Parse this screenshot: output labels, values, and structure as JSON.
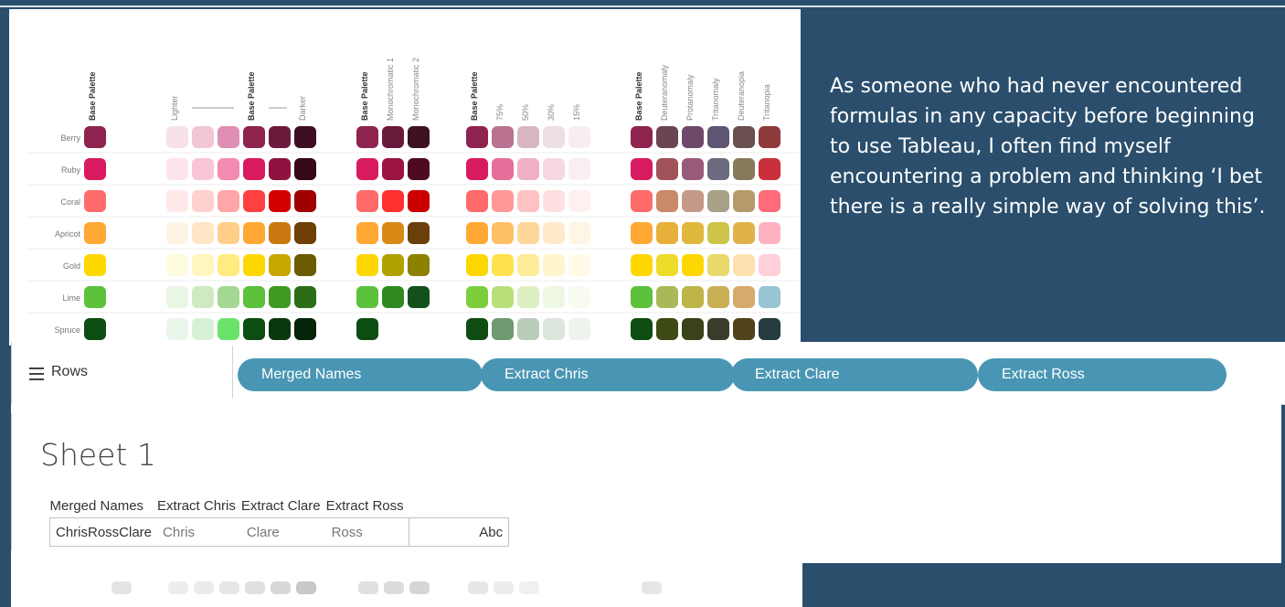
{
  "caption": "As someone who had never encountered formulas in any capacity before beginning to use Tableau, I often find myself encountering a problem and thinking ‘I bet there is a really simple way of solving this’.",
  "palette": {
    "column_headers": [
      "Base Palette",
      "Lighter",
      "Base Palette",
      "Darker",
      "Base Palette",
      "Monochromatic 1",
      "Monochromatic 2",
      "Base Palette",
      "75%",
      "50%",
      "30%",
      "15%",
      "Base Palette",
      "Deuteranomaly",
      "Protanomaly",
      "Tritanomaly",
      "Deuteranopia",
      "Tritanopia"
    ],
    "rows": [
      {
        "name": "Berry",
        "colors": [
          "#8f2350",
          "#f7e1ea",
          "#f2c6d6",
          "#df8fb1",
          "#8f2350",
          "#6b1a3c",
          "#3e0f22",
          "#8f2350",
          "#6a1a3b",
          "#3e1020",
          "#8f2350",
          "#b9728f",
          "#d9b5c4",
          "#ece0e5",
          "#f6eef1",
          "#8f2350",
          "#6b4552",
          "#6e4a6a",
          "#5e5572",
          "#6a4f4f",
          "#8f3a3d"
        ]
      },
      {
        "name": "Ruby",
        "colors": [
          "#d81b60",
          "#fde4ec",
          "#f9c6d8",
          "#f28ab1",
          "#d81b60",
          "#8f1240",
          "#360818",
          "#d81b60",
          "#9c1344",
          "#4d0a22",
          "#d81b60",
          "#e56f9a",
          "#f0b0c8",
          "#f7d7e3",
          "#fbeef3",
          "#d81b60",
          "#9f5257",
          "#9a5a7a",
          "#6c6a7e",
          "#857a5c",
          "#c9303c"
        ]
      },
      {
        "name": "Coral",
        "colors": [
          "#ff6b6b",
          "#ffe8e8",
          "#ffd0d0",
          "#ffa6a6",
          "#ff4040",
          "#d40000",
          "#a00000",
          "#ff6b6b",
          "#ff3030",
          "#cc0000",
          "#ff6b6b",
          "#ff9898",
          "#ffc2c2",
          "#ffe0e0",
          "#fff0f0",
          "#ff6b6b",
          "#c98a6a",
          "#c49a86",
          "#a9a088",
          "#b69a6a",
          "#ff6b78"
        ]
      },
      {
        "name": "Apricot",
        "colors": [
          "#ffa833",
          "#fff3e3",
          "#ffe6c4",
          "#ffcf8a",
          "#ffa833",
          "#c97910",
          "#6e3f05",
          "#ffa833",
          "#d98a16",
          "#6b3f0b",
          "#ffa833",
          "#ffc066",
          "#ffd799",
          "#ffe9c9",
          "#fff5e6",
          "#ffa833",
          "#e8b03a",
          "#e0b83d",
          "#cfc44a",
          "#e2b24a",
          "#ffb3c0"
        ]
      },
      {
        "name": "Gold",
        "colors": [
          "#ffd700",
          "#fffbe0",
          "#fff6bf",
          "#ffeb80",
          "#ffd700",
          "#c7a600",
          "#6b5a00",
          "#ffd700",
          "#b0a000",
          "#8e8000",
          "#ffd700",
          "#ffe24d",
          "#ffec99",
          "#fff5cc",
          "#fffbe8",
          "#ffd700",
          "#eedc2a",
          "#ffd700",
          "#e8d96a",
          "#ffe0b0",
          "#ffd0d8"
        ]
      },
      {
        "name": "Lime",
        "colors": [
          "#5cc13b",
          "#e8f6e3",
          "#cdeac2",
          "#a4d892",
          "#5cc13b",
          "#3f9a23",
          "#2b6e16",
          "#5cc13b",
          "#2f8a20",
          "#12501c",
          "#7ccf3b",
          "#b8e07a",
          "#dcefc0",
          "#eef7e4",
          "#f7fbf1",
          "#5cc13b",
          "#a9b95a",
          "#bdb548",
          "#c9b055",
          "#d7a96a",
          "#98c4d4"
        ]
      },
      {
        "name": "Spruce",
        "colors": [
          "#0e4d12",
          "#eaf6ea",
          "#d6f0d6",
          "#6be36b",
          "#0e4d12",
          "#0a380d",
          "#062408",
          "#0e4d12",
          "#6e9a70",
          "#c9d9c9",
          "#0e4d12",
          "#6e9a70",
          "#b8ccb8",
          "#dce6dc",
          "#eef3ee",
          "#0e4d12",
          "#3d4a13",
          "#3a4219",
          "#3b3b2a",
          "#51421a",
          "#253b3f"
        ]
      }
    ]
  },
  "shelf": {
    "label": "Rows",
    "pills": [
      "Merged Names",
      "Extract Chris",
      "Extract Clare",
      "Extract Ross"
    ]
  },
  "sheet": {
    "title": "Sheet 1",
    "columns": [
      "Merged Names",
      "Extract Chris",
      "Extract Clare",
      "Extract Ross"
    ],
    "row": [
      "ChrisRossClare",
      "Chris",
      "Clare",
      "Ross"
    ],
    "abc": "Abc"
  }
}
